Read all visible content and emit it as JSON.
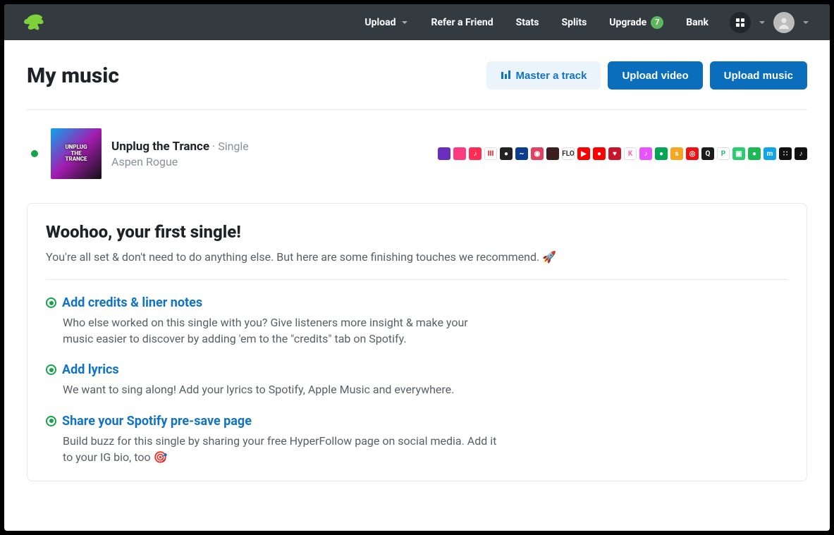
{
  "nav": {
    "upload": "Upload",
    "refer": "Refer a Friend",
    "stats": "Stats",
    "splits": "Splits",
    "upgrade": "Upgrade",
    "upgrade_badge": "7",
    "bank": "Bank"
  },
  "page": {
    "title": "My music"
  },
  "actions": {
    "master": "Master a track",
    "upload_video": "Upload video",
    "upload_music": "Upload music"
  },
  "release": {
    "title": "Unplug the Trance",
    "type_suffix": " · Single",
    "artist": "Aspen Rogue"
  },
  "stores": [
    {
      "bg": "#6b2fbf",
      "t": ""
    },
    {
      "bg": "#ff3b7f",
      "t": ""
    },
    {
      "bg": "#ff2d55",
      "t": "♪"
    },
    {
      "bg": "#ffffff",
      "t": "III",
      "fg": "#e11"
    },
    {
      "bg": "#222",
      "t": "●"
    },
    {
      "bg": "#0b3d91",
      "t": "~"
    },
    {
      "bg": "#e4405f",
      "t": "◉"
    },
    {
      "bg": "#3b1f1f",
      "t": ""
    },
    {
      "bg": "#fff",
      "t": "FLO",
      "fg": "#333"
    },
    {
      "bg": "#ff0000",
      "t": "▶"
    },
    {
      "bg": "#ff0000",
      "t": "●"
    },
    {
      "bg": "#c6162c",
      "t": "♥"
    },
    {
      "bg": "#fff",
      "t": "K",
      "fg": "#f6a"
    },
    {
      "bg": "#e754ff",
      "t": "♪"
    },
    {
      "bg": "#00a651",
      "t": "●"
    },
    {
      "bg": "#f5a623",
      "t": "s"
    },
    {
      "bg": "#e11",
      "t": "◎"
    },
    {
      "bg": "#1c1c1c",
      "t": "Q"
    },
    {
      "bg": "#fff",
      "t": "P",
      "fg": "#2b7"
    },
    {
      "bg": "#2ecc71",
      "t": "▣"
    },
    {
      "bg": "#1db954",
      "t": "●"
    },
    {
      "bg": "#0ea5e9",
      "t": "m"
    },
    {
      "bg": "#111",
      "t": "∷"
    },
    {
      "bg": "#111",
      "t": "♪"
    }
  ],
  "card": {
    "heading": "Woohoo, your first single!",
    "sub": "You're all set & don't need to do anything else. But here are some finishing touches we recommend. 🚀"
  },
  "recs": [
    {
      "title": "Add credits & liner notes",
      "body": "Who else worked on this single with you? Give listeners more insight & make your music easier to discover by adding 'em to the \"credits\" tab on Spotify."
    },
    {
      "title": "Add lyrics",
      "body": "We want to sing along! Add your lyrics to Spotify, Apple Music and everywhere."
    },
    {
      "title": "Share your Spotify pre-save page",
      "body": "Build buzz for this single by sharing your free HyperFollow page on social media. Add it to your IG bio, too 🎯"
    }
  ]
}
